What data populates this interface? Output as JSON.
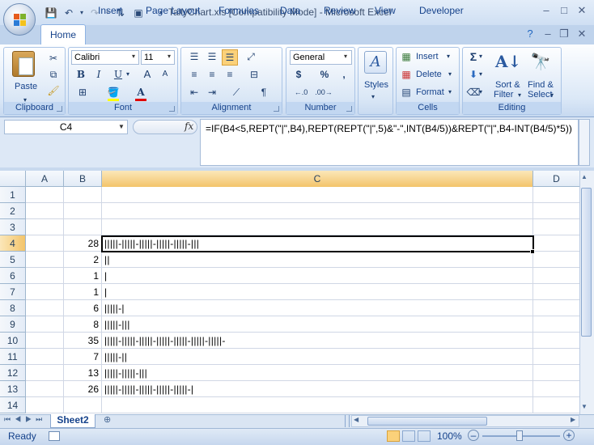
{
  "window": {
    "title": "TallyChart.xls  [Compatibility Mode] - Microsoft Excel"
  },
  "tabs": [
    "Home",
    "Insert",
    "Page Layout",
    "Formulas",
    "Data",
    "Review",
    "View",
    "Developer"
  ],
  "ribbon": {
    "clipboard": {
      "label": "Clipboard",
      "paste": "Paste"
    },
    "font": {
      "label": "Font",
      "name": "Calibri",
      "size": "11",
      "bold": "B",
      "italic": "I",
      "underline": "U",
      "grow": "A",
      "shrink": "A"
    },
    "alignment": {
      "label": "Alignment"
    },
    "number": {
      "label": "Number",
      "format": "General",
      "currency": "$",
      "percent": "%",
      "comma": ","
    },
    "styles": {
      "label": "Styles"
    },
    "cells": {
      "label": "Cells",
      "insert": "Insert",
      "delete": "Delete",
      "format": "Format"
    },
    "editing": {
      "label": "Editing",
      "sort": "Sort &",
      "filter": "Filter",
      "find": "Find &",
      "select": "Select",
      "sigma": "Σ"
    }
  },
  "formula_bar": {
    "name_box": "C4",
    "fx": "fx",
    "formula": "=IF(B4<5,REPT(\"|\",B4),REPT(REPT(\"|\",5)&\"-\",INT(B4/5))&REPT(\"|\",B4-INT(B4/5)*5))"
  },
  "columns": [
    "A",
    "B",
    "C",
    "D"
  ],
  "rows": [
    {
      "n": "1",
      "b": "",
      "c": ""
    },
    {
      "n": "2",
      "b": "",
      "c": ""
    },
    {
      "n": "3",
      "b": "",
      "c": ""
    },
    {
      "n": "4",
      "b": "28",
      "c": "|||||-|||||-|||||-|||||-|||||-|||"
    },
    {
      "n": "5",
      "b": "2",
      "c": "||"
    },
    {
      "n": "6",
      "b": "1",
      "c": "|"
    },
    {
      "n": "7",
      "b": "1",
      "c": "|"
    },
    {
      "n": "8",
      "b": "6",
      "c": "|||||-|"
    },
    {
      "n": "9",
      "b": "8",
      "c": "|||||-|||"
    },
    {
      "n": "10",
      "b": "35",
      "c": "|||||-|||||-|||||-|||||-|||||-|||||-|||||-"
    },
    {
      "n": "11",
      "b": "7",
      "c": "|||||-||"
    },
    {
      "n": "12",
      "b": "13",
      "c": "|||||-|||||-|||"
    },
    {
      "n": "13",
      "b": "26",
      "c": "|||||-|||||-|||||-|||||-|||||-|"
    },
    {
      "n": "14",
      "b": "",
      "c": ""
    }
  ],
  "sheet_tab": "Sheet2",
  "status": {
    "ready": "Ready",
    "zoom": "100%"
  },
  "colors": {
    "accent": "#15428b",
    "selection_header": "#f9d89a"
  }
}
